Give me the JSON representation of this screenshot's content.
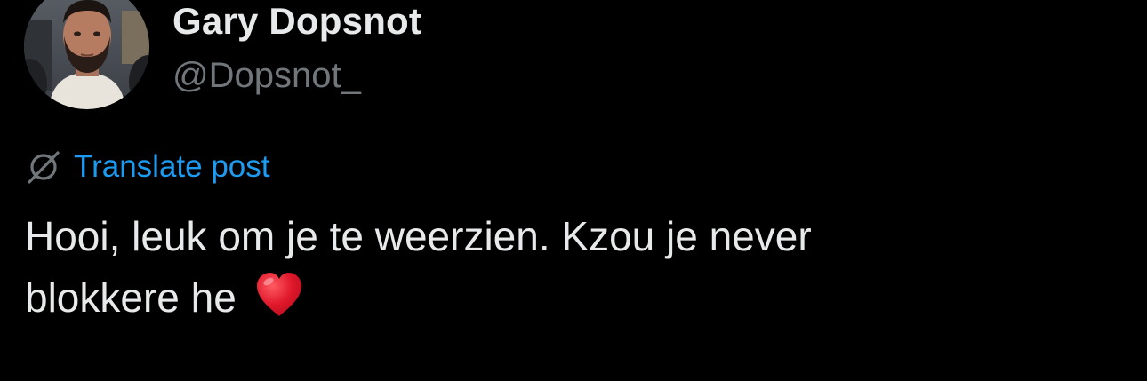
{
  "author": {
    "display_name": "Gary Dopsnot",
    "handle": "@Dopsnot_",
    "avatar_icon": "profile-photo"
  },
  "translate": {
    "icon": "globe-slash-icon",
    "label": "Translate post"
  },
  "post": {
    "text_line1": "Hooi, leuk om je te weerzien. Kzou je never",
    "text_line2": "blokkere he",
    "emoji": "heart-icon"
  },
  "colors": {
    "background": "#000000",
    "primary_text": "#e7e9ea",
    "secondary_text": "#71767b",
    "link": "#1d9bf0",
    "heart": "#e0182b"
  }
}
